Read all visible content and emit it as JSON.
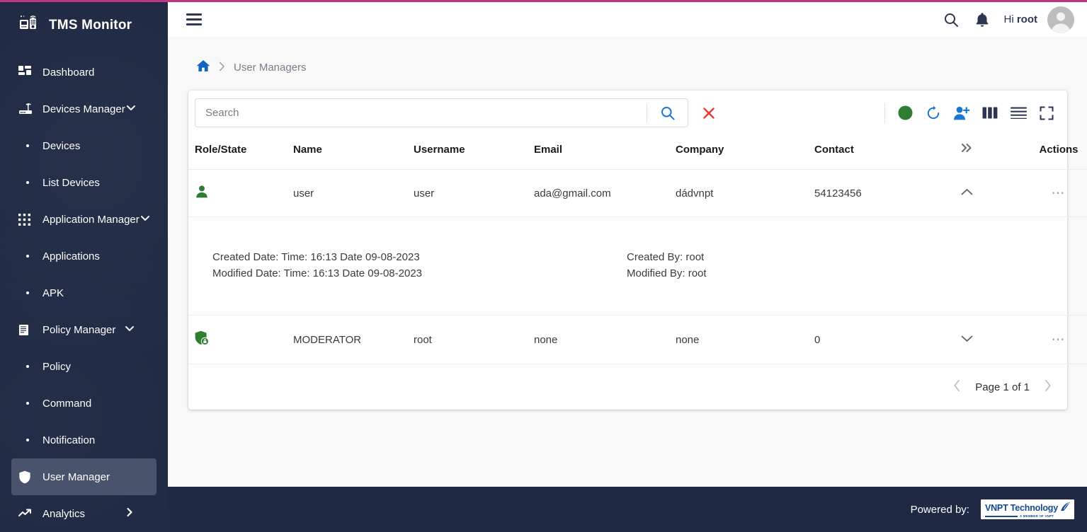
{
  "app": {
    "brand": "TMS Monitor",
    "accent_color": "#c13584",
    "sidebar_color": "#1f2943"
  },
  "sidebar": {
    "items": [
      {
        "label": "Dashboard",
        "icon": "dashboard-icon",
        "type": "item",
        "chevron": "",
        "active": false
      },
      {
        "label": "Devices Manager",
        "icon": "router-icon",
        "type": "item",
        "chevron": "down",
        "active": false
      },
      {
        "label": "Devices",
        "icon": "bullet",
        "type": "sub",
        "chevron": "",
        "active": false
      },
      {
        "label": "List Devices",
        "icon": "bullet",
        "type": "sub",
        "chevron": "",
        "active": false
      },
      {
        "label": "Application Manager",
        "icon": "apps-grid-icon",
        "type": "item",
        "chevron": "down",
        "active": false
      },
      {
        "label": "Applications",
        "icon": "bullet",
        "type": "sub",
        "chevron": "",
        "active": false
      },
      {
        "label": "APK",
        "icon": "bullet",
        "type": "sub",
        "chevron": "",
        "active": false
      },
      {
        "label": "Policy Manager",
        "icon": "policy-list-icon",
        "type": "item",
        "chevron": "down",
        "active": false
      },
      {
        "label": "Policy",
        "icon": "bullet",
        "type": "sub",
        "chevron": "",
        "active": false
      },
      {
        "label": "Command",
        "icon": "bullet",
        "type": "sub",
        "chevron": "",
        "active": false
      },
      {
        "label": "Notification",
        "icon": "bullet",
        "type": "sub",
        "chevron": "",
        "active": false
      },
      {
        "label": "User Manager",
        "icon": "shield-icon",
        "type": "item",
        "chevron": "",
        "active": true
      },
      {
        "label": "Analytics",
        "icon": "trending-up-icon",
        "type": "item",
        "chevron": "right",
        "active": false
      }
    ]
  },
  "header": {
    "menu_icon": "hamburger-icon",
    "search_icon": "search-icon",
    "notification_icon": "bell-icon",
    "greeting_prefix": "Hi ",
    "user": "root",
    "avatar_icon": "user-avatar-icon"
  },
  "breadcrumb": {
    "home_icon": "home-icon",
    "separator": "›",
    "current": "User Managers"
  },
  "toolbar": {
    "search_value": "",
    "search_placeholder": "Search",
    "search_button_icon": "search-icon",
    "clear_button_icon": "close-x-icon",
    "actions": [
      {
        "name": "status-indicator",
        "icon": "green-circle-icon",
        "color": "#2e7d32"
      },
      {
        "name": "refresh-button",
        "icon": "refresh-icon",
        "color": "#1976d2"
      },
      {
        "name": "add-user-button",
        "icon": "person-add-icon",
        "color": "#1976d2"
      },
      {
        "name": "columns-button",
        "icon": "columns-icon",
        "color": "#2c3552"
      },
      {
        "name": "list-view-button",
        "icon": "list-lines-icon",
        "color": "#2c3552"
      },
      {
        "name": "fullscreen-button",
        "icon": "fullscreen-icon",
        "color": "#2c3552"
      }
    ]
  },
  "table": {
    "columns": [
      "Role/State",
      "Name",
      "Username",
      "Email",
      "Company",
      "Contact",
      "»",
      "Actions"
    ],
    "rows": [
      {
        "role_icon": "person-user-icon",
        "role_color": "#2e7d32",
        "name": "user",
        "username": "user",
        "email": "ada@gmail.com",
        "company": "dádvnpt",
        "contact": "54123456",
        "expand_state": "expanded",
        "actions_icon": "more-horizontal-icon",
        "detail": {
          "created_date": "Created Date: Time: 16:13 Date 09-08-2023",
          "modified_date": "Modified Date: Time: 16:13 Date 09-08-2023",
          "created_by": "Created By: root",
          "modified_by": "Modified By: root"
        }
      },
      {
        "role_icon": "shield-lock-icon",
        "role_color": "#2e7d32",
        "name": "MODERATOR",
        "username": "root",
        "email": "none",
        "company": "none",
        "contact": "0",
        "expand_state": "collapsed",
        "actions_icon": "more-horizontal-icon",
        "detail": null
      }
    ]
  },
  "pagination": {
    "prev_icon": "chevron-left-icon",
    "label": "Page 1 of 1",
    "next_icon": "chevron-right-icon"
  },
  "footer": {
    "powered_by": "Powered by:",
    "logo_main": "VNPT Technology",
    "logo_sub": "A MEMBER OF VNPT"
  }
}
